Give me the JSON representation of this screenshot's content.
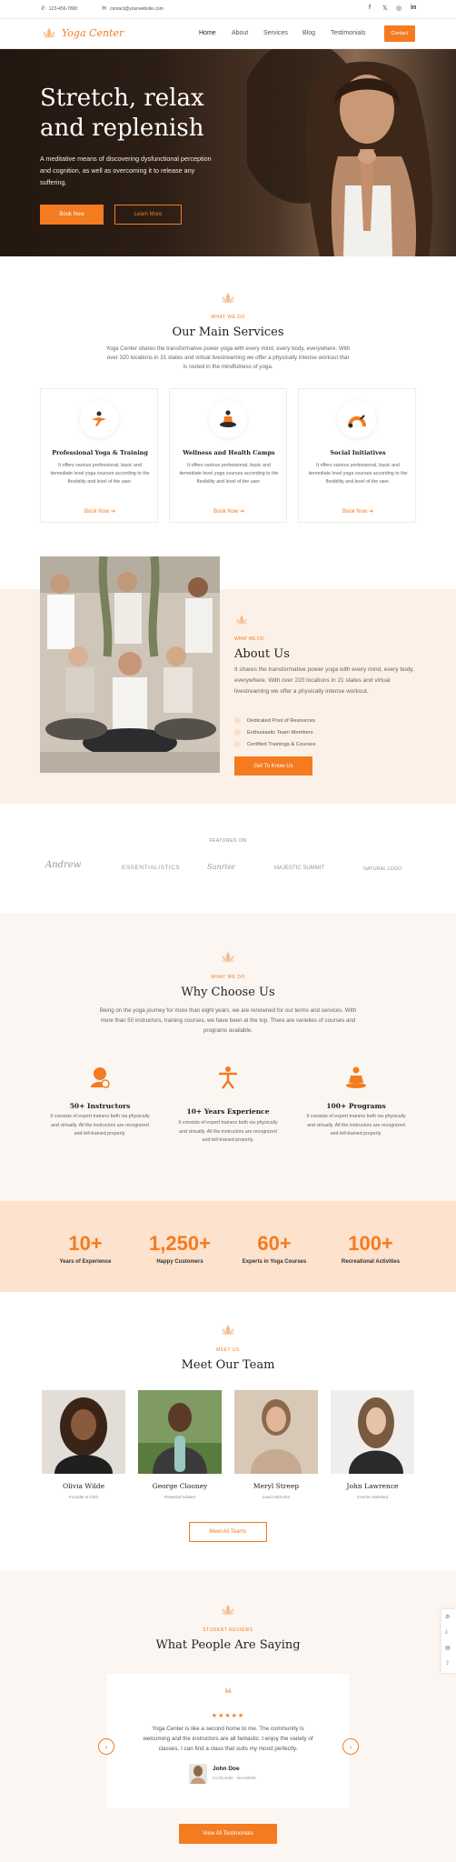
{
  "topbar": {
    "phone": "123-456-7890",
    "email": "contact@yourwebsite.com",
    "social": [
      "facebook-icon",
      "x-icon",
      "instagram-icon",
      "linkedin-icon"
    ]
  },
  "nav": {
    "logo": "Yoga Center",
    "links": [
      "Home",
      "About",
      "Services",
      "Blog",
      "Testimonials"
    ],
    "contact": "Contact"
  },
  "hero": {
    "title": "Stretch, relax and replenish",
    "text": "A meditative means of discovering dysfunctional perception and cognition, as well as overcoming it to release any suffering.",
    "book": "Book Now",
    "learn": "Learn More"
  },
  "services": {
    "kicker": "WHAT WE DO",
    "title": "Our Main Services",
    "subtitle": "Yoga Center shares the transformative power yoga with every mind, every body, everywhere. With over 320 locations in 31 states and virtual livestreaming we offer a physically intense workout that is rooted in the mindfulness of yoga.",
    "cards": [
      {
        "title": "Professional Yoga & Training",
        "text": "It offers various professional, basic and itemediate level yoga courses according to the flexibility and level of the user.",
        "link": "Book Now"
      },
      {
        "title": "Wellness and Health Camps",
        "text": "It offers various professional, basic and itemediate level yoga courses according to the flexibility and level of the user.",
        "link": "Book Now"
      },
      {
        "title": "Social Initiatives",
        "text": "It offers various professional, basic and itemediate level yoga courses according to the flexibility and level of the user.",
        "link": "Book Now"
      }
    ]
  },
  "about": {
    "kicker": "WHAT WE DO",
    "title": "About Us",
    "text": "It shares the transformative power yoga with every mind, every body, everywhere. With over 220 locations in 21 states and virtual livestreaming we offer a physically intense workout.",
    "list": [
      "Dedicated Pool of Resources",
      "Enthusiastic Team Members",
      "Certified Trainings & Courses"
    ],
    "button": "Get To Know Us"
  },
  "featured": {
    "label": "FEATURED ON",
    "logos": [
      "Andrew",
      "ESSENTIALISTICS",
      "Sunrise",
      "MAJESTIC SUMMIT",
      "NATURAL LOGO"
    ]
  },
  "why": {
    "kicker": "WHAT WE DO",
    "title": "Why Choose Us",
    "subtitle": "Being on the yoga journey for more than eight years, we are renowned for our terms and services. With more than 50 instructors, training courses, we have been at the top. There are varieties of courses and programs available.",
    "cards": [
      {
        "title": "50+ Instructors",
        "text": "It consists of expert trainers both via physically and virtually. All the instructors are recognized and tell-trained properly."
      },
      {
        "title": "10+ Years Experience",
        "text": "It consists of expert trainers both via physically and virtually. All the instructors are recognized and tell-trained properly."
      },
      {
        "title": "100+ Programs",
        "text": "It consists of expert trainers both via physically and virtually. All the instructors are recognized and tell-trained properly."
      }
    ]
  },
  "stats": [
    {
      "value": "10+",
      "label": "Years of Experience"
    },
    {
      "value": "1,250+",
      "label": "Happy Customers"
    },
    {
      "value": "60+",
      "label": "Experts in Yoga Courses"
    },
    {
      "value": "100+",
      "label": "Recreational Activities"
    }
  ],
  "team": {
    "kicker": "MEET US",
    "title": "Meet Our Team",
    "members": [
      {
        "name": "Olivia Wilde",
        "role": "Founder & CEO"
      },
      {
        "name": "George Clooney",
        "role": "Financial Adviser"
      },
      {
        "name": "Meryl Streep",
        "role": "Lead Instructor"
      },
      {
        "name": "John Lawrence",
        "role": "Course Assistant"
      }
    ],
    "button": "Meet All Teams"
  },
  "testimonials": {
    "kicker": "STUDENT REVIEWS",
    "title": "What People Are Saying",
    "quote": "Yoga Center is like a second home to me. The community is welcoming and the instructors are all fantastic. I enjoy the variety of classes, I can find a class that suits my mood perfectly.",
    "stars": "★★★★★",
    "name": "John Doe",
    "role": "Co-founder · Brookfield",
    "button": "View All Testimonials"
  },
  "colors": {
    "accent": "#f47b20",
    "peach": "#fde2cd",
    "cream": "#fcf1e8"
  }
}
